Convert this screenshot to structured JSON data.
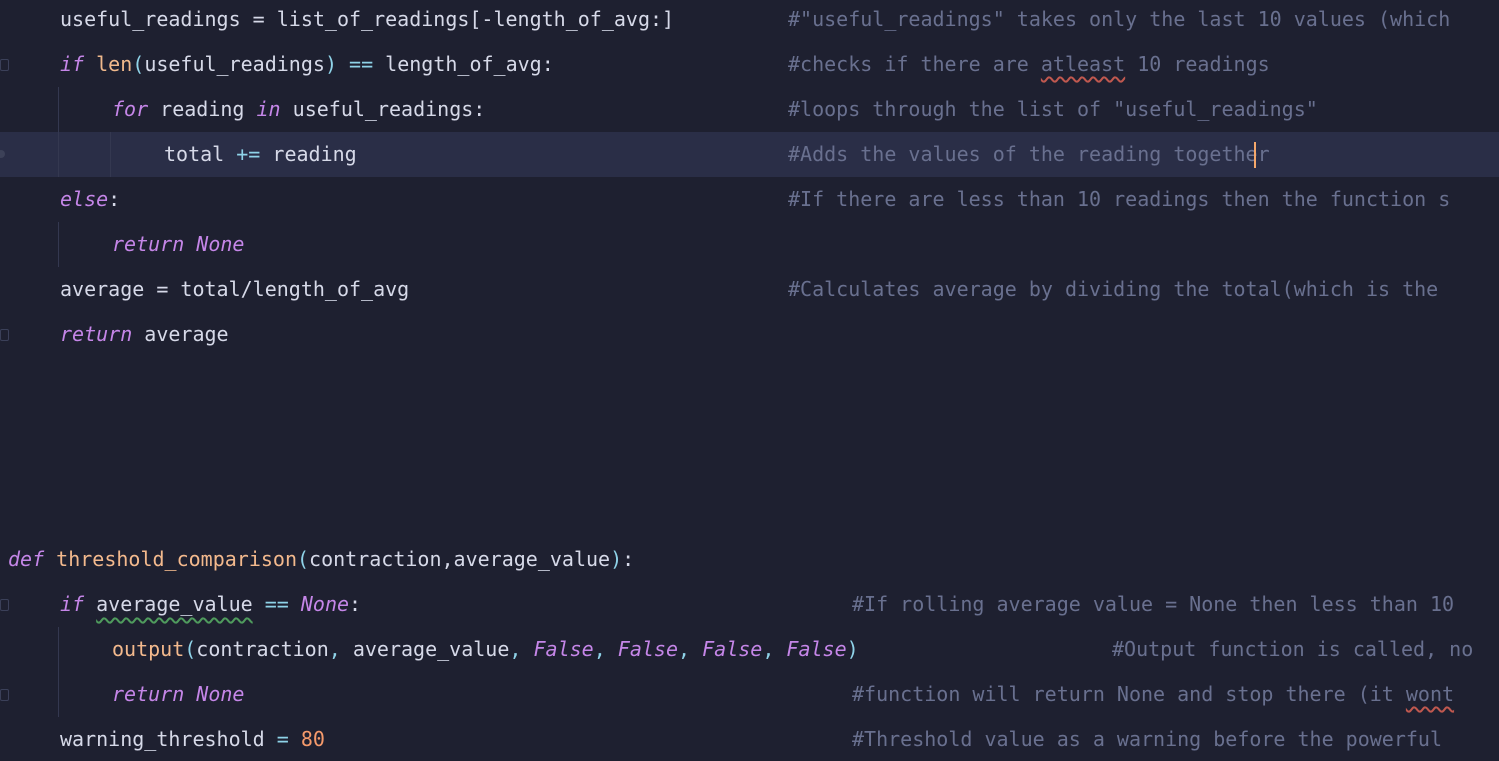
{
  "lines": {
    "l1": {
      "code": "useful_readings = list_of_readings[-length_of_avg:]",
      "comment": "#\"useful_readings\" takes only the last 10 values (which"
    },
    "l2": {
      "kw": "if",
      "call": "len",
      "arg": "useful_readings",
      "op": "==",
      "rhs": "length_of_avg",
      "colon": ":",
      "comment_pre": "#checks if there are ",
      "comment_squiggle": "atleast",
      "comment_post": " 10 readings"
    },
    "l3": {
      "kw1": "for",
      "var": "reading",
      "kw2": "in",
      "iter": "useful_readings",
      "colon": ":",
      "comment": "#loops through the list of \"useful_readings\""
    },
    "l4": {
      "target": "total",
      "op": "+=",
      "value": "reading",
      "comment": "#Adds the values of the reading together"
    },
    "l5": {
      "kw": "else",
      "colon": ":",
      "comment": "#If there are less than 10 readings then the function s"
    },
    "l6": {
      "kw": "return",
      "const": "None"
    },
    "l7": {
      "code": "average = total/length_of_avg",
      "comment": "#Calculates average by dividing the total(which is the"
    },
    "l8": {
      "kw": "return",
      "value": "average"
    },
    "l9": {
      "kw": "def",
      "name": "threshold_comparison",
      "open": "(",
      "params": "contraction,average_value",
      "close": ")",
      "colon": ":"
    },
    "l10": {
      "kw": "if",
      "var": "average_value",
      "op": "==",
      "const": "None",
      "colon": ":",
      "comment": "#If rolling average value = None then less than 10"
    },
    "l11": {
      "call": "output",
      "args": [
        "contraction",
        "average_value"
      ],
      "consts": [
        "False",
        "False",
        "False",
        "False"
      ],
      "comment": "#Output function is called, no"
    },
    "l12": {
      "kw": "return",
      "const": "None",
      "comment_pre": "#function will return None and stop there (it ",
      "comment_squiggle": "wont"
    },
    "l13": {
      "target": "warning_threshold",
      "op": "=",
      "num": "80",
      "comment": "#Threshold value as a warning before the powerful"
    }
  },
  "colors": {
    "background": "#1e2030",
    "current_line": "#2a2e47",
    "keyword": "#c586e8",
    "function": "#f3b98d",
    "number": "#f59a6b",
    "comment": "#69708f",
    "caret": "#f5a86b"
  }
}
